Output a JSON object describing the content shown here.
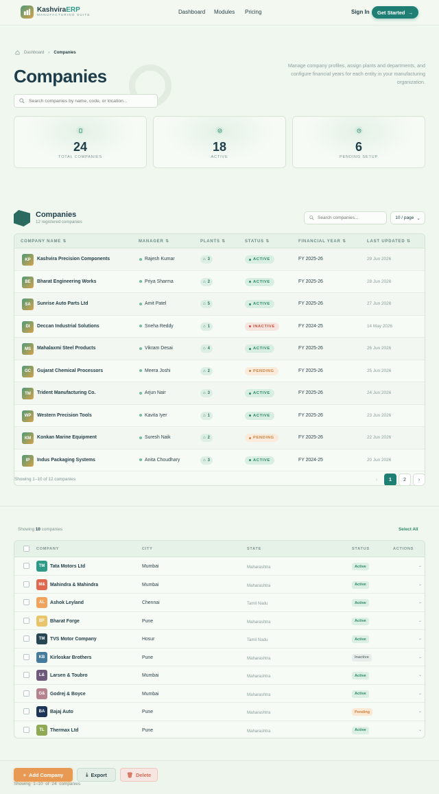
{
  "nav": {
    "brand_main": "Kashvira",
    "brand_accent": "ERP",
    "brand_sub": "MANUFACTURING SUITE",
    "links": [
      "Dashboard",
      "Modules",
      "Pricing"
    ],
    "signin": "Sign In",
    "cta": "Get Started"
  },
  "hero": {
    "breadcrumb": [
      "Dashboard",
      "Companies"
    ],
    "title": "Companies",
    "description": "Manage company profiles, assign plants and departments, and configure financial years for each entity in your manufacturing organization.",
    "search_placeholder": "Search companies by name, code, or location..."
  },
  "stats": [
    {
      "value": "24",
      "label": "TOTAL COMPANIES",
      "icon": "building-icon"
    },
    {
      "value": "18",
      "label": "ACTIVE",
      "icon": "check-circle-icon"
    },
    {
      "value": "6",
      "label": "PENDING SETUP",
      "icon": "clock-icon"
    }
  ],
  "table1": {
    "title": "Companies",
    "subtitle": "12 registered companies",
    "search_placeholder": "Search companies...",
    "per_page": "10 / page",
    "headers": [
      "COMPANY NAME",
      "MANAGER",
      "PLANTS",
      "STATUS",
      "FINANCIAL YEAR",
      "LAST UPDATED"
    ],
    "rows": [
      {
        "initials": "KP",
        "name": "Kashvira Precision Components",
        "manager": "Rajesh Kumar",
        "plants": "3",
        "status": "ACTIVE",
        "fy": "FY 2025-26",
        "updated": "29 Jun 2026"
      },
      {
        "initials": "BE",
        "name": "Bharat Engineering Works",
        "manager": "Priya Sharma",
        "plants": "2",
        "status": "ACTIVE",
        "fy": "FY 2025-26",
        "updated": "28 Jun 2026"
      },
      {
        "initials": "SA",
        "name": "Sunrise Auto Parts Ltd",
        "manager": "Amit Patel",
        "plants": "5",
        "status": "ACTIVE",
        "fy": "FY 2025-26",
        "updated": "27 Jun 2026"
      },
      {
        "initials": "DI",
        "name": "Deccan Industrial Solutions",
        "manager": "Sneha Reddy",
        "plants": "1",
        "status": "INACTIVE",
        "fy": "FY 2024-25",
        "updated": "14 May 2026"
      },
      {
        "initials": "MS",
        "name": "Mahalaxmi Steel Products",
        "manager": "Vikram Desai",
        "plants": "4",
        "status": "ACTIVE",
        "fy": "FY 2025-26",
        "updated": "26 Jun 2026"
      },
      {
        "initials": "GC",
        "name": "Gujarat Chemical Processors",
        "manager": "Meera Joshi",
        "plants": "2",
        "status": "PENDING",
        "fy": "FY 2025-26",
        "updated": "25 Jun 2026"
      },
      {
        "initials": "TM",
        "name": "Trident Manufacturing Co.",
        "manager": "Arjun Nair",
        "plants": "3",
        "status": "ACTIVE",
        "fy": "FY 2025-26",
        "updated": "24 Jun 2026"
      },
      {
        "initials": "WP",
        "name": "Western Precision Tools",
        "manager": "Kavita Iyer",
        "plants": "1",
        "status": "ACTIVE",
        "fy": "FY 2025-26",
        "updated": "23 Jun 2026"
      },
      {
        "initials": "KM",
        "name": "Konkan Marine Equipment",
        "manager": "Suresh Naik",
        "plants": "2",
        "status": "PENDING",
        "fy": "FY 2025-26",
        "updated": "22 Jun 2026"
      },
      {
        "initials": "IP",
        "name": "Indus Packaging Systems",
        "manager": "Anita Choudhary",
        "plants": "3",
        "status": "ACTIVE",
        "fy": "FY 2024-25",
        "updated": "20 Jun 2026"
      }
    ],
    "footer": "Showing 1–10 of 12 companies",
    "pages": [
      "1",
      "2"
    ]
  },
  "table2": {
    "showing_prefix": "Showing",
    "showing_count": "10",
    "showing_suffix": "companies",
    "select_all": "Select All",
    "headers": [
      "COMPANY",
      "CITY",
      "STATE",
      "STATUS",
      "ACTIONS"
    ],
    "rows": [
      {
        "initials": "TM",
        "name": "Tata Motors Ltd",
        "city": "Mumbai",
        "state": "Maharashtra",
        "status": "Active",
        "color": "#2f9a88"
      },
      {
        "initials": "M&",
        "name": "Mahindra & Mahindra",
        "city": "Mumbai",
        "state": "Maharashtra",
        "status": "Active",
        "color": "#e0684f"
      },
      {
        "initials": "AL",
        "name": "Ashok Leyland",
        "city": "Chennai",
        "state": "Tamil Nadu",
        "status": "Active",
        "color": "#efa35b"
      },
      {
        "initials": "BF",
        "name": "Bharat Forge",
        "city": "Pune",
        "state": "Maharashtra",
        "status": "Active",
        "color": "#e9c46a"
      },
      {
        "initials": "TM",
        "name": "TVS Motor Company",
        "city": "Hosur",
        "state": "Tamil Nadu",
        "status": "Active",
        "color": "#264653"
      },
      {
        "initials": "KB",
        "name": "Kirloskar Brothers",
        "city": "Pune",
        "state": "Maharashtra",
        "status": "Inactive",
        "color": "#457b9d"
      },
      {
        "initials": "L&",
        "name": "Larsen & Toubro",
        "city": "Mumbai",
        "state": "Maharashtra",
        "status": "Active",
        "color": "#6d597a"
      },
      {
        "initials": "G&",
        "name": "Godrej & Boyce",
        "city": "Mumbai",
        "state": "Maharashtra",
        "status": "Active",
        "color": "#b5838d"
      },
      {
        "initials": "BA",
        "name": "Bajaj Auto",
        "city": "Pune",
        "state": "Maharashtra",
        "status": "Pending",
        "color": "#1d3557"
      },
      {
        "initials": "TL",
        "name": "Thermax Ltd",
        "city": "Pune",
        "state": "Maharashtra",
        "status": "Active",
        "color": "#90a955"
      }
    ]
  },
  "bottom": {
    "add": "Add Company",
    "export": "Export",
    "delete": "Delete",
    "showing": "Showing 1–10 of 24 companies"
  }
}
